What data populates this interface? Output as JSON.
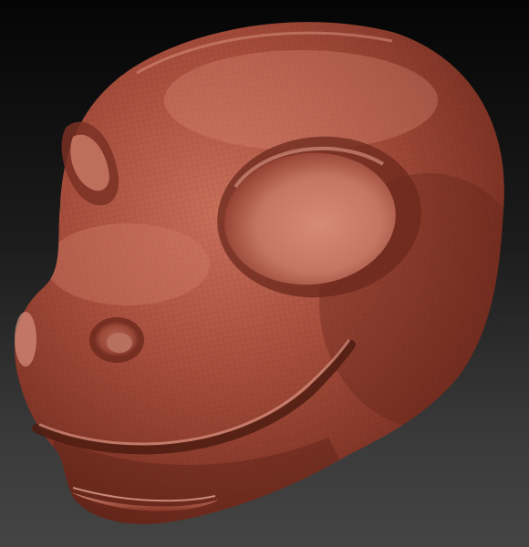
{
  "scene": {
    "subject": "sculpted-creature-head",
    "material": "clay-red",
    "colors": {
      "background_top": "#050505",
      "background_bottom": "#444444",
      "clay_light": "#d07a66",
      "clay_mid": "#a8503f",
      "clay_dark": "#5e2318",
      "wire": "#3a140e"
    }
  }
}
